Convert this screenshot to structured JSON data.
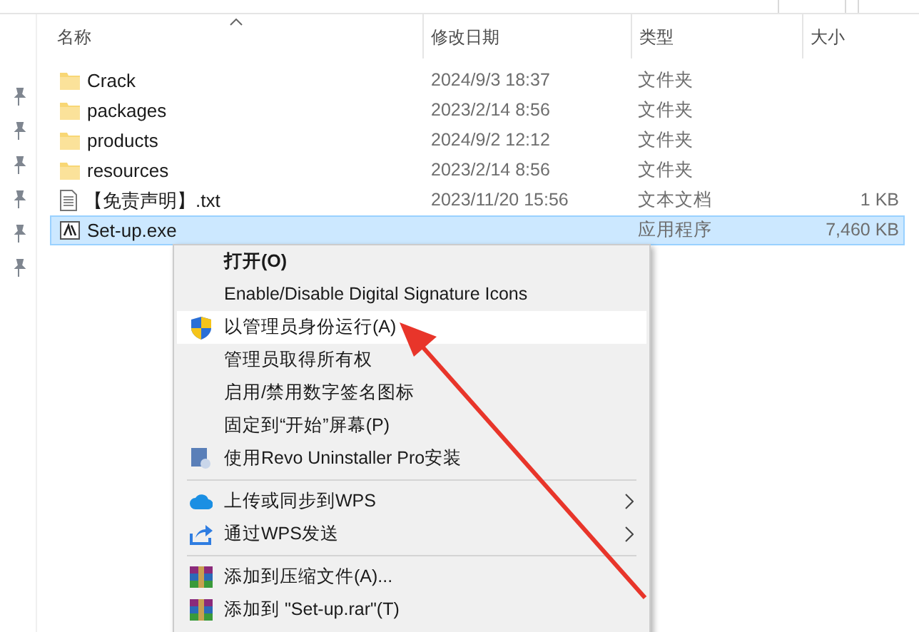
{
  "columns": [
    {
      "label": "名称"
    },
    {
      "label": "修改日期"
    },
    {
      "label": "类型"
    },
    {
      "label": "大小"
    }
  ],
  "files": [
    {
      "kind": "folder",
      "name": "Crack",
      "modified": "2024/9/3 18:37",
      "type": "文件夹",
      "selected": false
    },
    {
      "kind": "folder",
      "name": "packages",
      "modified": "2023/2/14 8:56",
      "type": "文件夹",
      "selected": false
    },
    {
      "kind": "folder",
      "name": "products",
      "modified": "2024/9/2 12:12",
      "type": "文件夹",
      "selected": false
    },
    {
      "kind": "folder",
      "name": "resources",
      "modified": "2023/2/14 8:56",
      "type": "文件夹",
      "selected": false
    },
    {
      "kind": "text",
      "name": "【免责声明】.txt",
      "modified": "2023/11/20 15:56",
      "type": "文本文档",
      "size": "1 KB",
      "selected": false
    },
    {
      "kind": "program",
      "name": "Set-up.exe",
      "type": "应用程序",
      "size": "7,460 KB",
      "selected": true
    }
  ],
  "context_menu": {
    "items": [
      {
        "kind": "default",
        "label": "打开(O)",
        "selected": false,
        "submenu": false
      },
      {
        "kind": "plain",
        "label": "Enable/Disable Digital Signature Icons",
        "selected": false,
        "submenu": false
      },
      {
        "kind": "shield",
        "label": "以管理员身份运行(A)",
        "selected": true,
        "submenu": false
      },
      {
        "kind": "plain",
        "label": "管理员取得所有权",
        "selected": false,
        "submenu": false
      },
      {
        "kind": "plain",
        "label": "启用/禁用数字签名图标",
        "selected": false,
        "submenu": false
      },
      {
        "kind": "plain",
        "label": "固定到“开始”屏幕(P)",
        "selected": false,
        "submenu": false
      },
      {
        "kind": "installer",
        "label": "使用Revo Uninstaller Pro安装",
        "selected": false,
        "submenu": false
      },
      {
        "kind": "separator"
      },
      {
        "kind": "cloud",
        "label": "上传或同步到WPS",
        "selected": false,
        "submenu": true
      },
      {
        "kind": "share",
        "label": "通过WPS发送",
        "selected": false,
        "submenu": true
      },
      {
        "kind": "separator"
      },
      {
        "kind": "archive",
        "label": "添加到压缩文件(A)...",
        "selected": false,
        "submenu": false
      },
      {
        "kind": "archive",
        "label": "添加到 \"Set-up.rar\"(T)",
        "selected": false,
        "submenu": false
      }
    ]
  }
}
